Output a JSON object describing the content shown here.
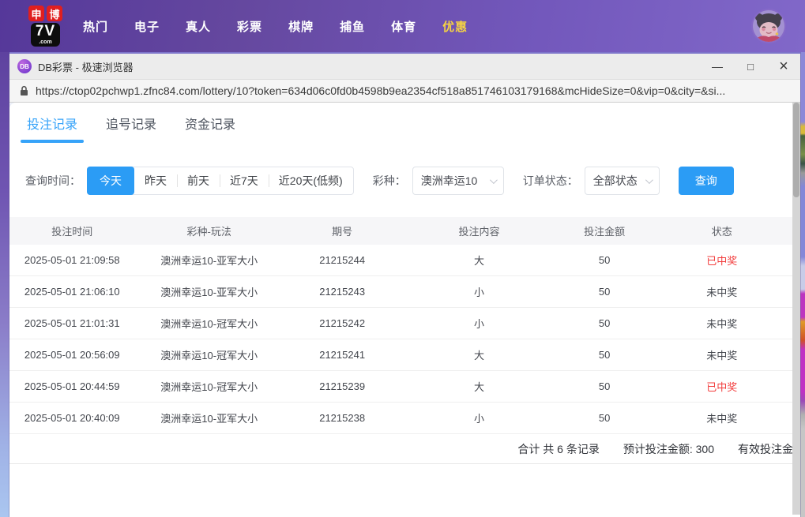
{
  "top_nav": {
    "logo": {
      "badge_left": "申",
      "badge_right": "博",
      "main": "7V",
      "sub": ".com"
    },
    "items": [
      {
        "label": "热门"
      },
      {
        "label": "电子"
      },
      {
        "label": "真人"
      },
      {
        "label": "彩票"
      },
      {
        "label": "棋牌"
      },
      {
        "label": "捕鱼"
      },
      {
        "label": "体育"
      },
      {
        "label": "优惠",
        "highlighted": true
      }
    ]
  },
  "browser": {
    "title": "DB彩票 - 极速浏览器",
    "favicon_text": "DB",
    "url": "https://ctop02pchwp1.zfnc84.com/lottery/10?token=634d06c0fd0b4598b9ea2354cf518a851746103179168&mcHideSize=0&vip=0&city=&si...",
    "controls": {
      "minimize": "—",
      "maximize": "□",
      "close": "×"
    }
  },
  "tabs": [
    {
      "label": "投注记录",
      "active": true
    },
    {
      "label": "追号记录",
      "active": false
    },
    {
      "label": "资金记录",
      "active": false
    }
  ],
  "filters": {
    "time_label": "查询时间：",
    "time_options": [
      {
        "label": "今天",
        "active": true
      },
      {
        "label": "昨天",
        "active": false
      },
      {
        "label": "前天",
        "active": false
      },
      {
        "label": "近7天",
        "active": false
      },
      {
        "label": "近20天(低频)",
        "active": false
      }
    ],
    "lottery_label": "彩种：",
    "lottery_value": "澳洲幸运10",
    "status_label": "订单状态：",
    "status_value": "全部状态",
    "search_label": "查询"
  },
  "table": {
    "columns": [
      "投注时间",
      "彩种-玩法",
      "期号",
      "投注内容",
      "投注金额",
      "状态"
    ],
    "rows": [
      {
        "time": "2025-05-01 21:09:58",
        "game": "澳洲幸运10-亚军大小",
        "issue": "21215244",
        "content": "大",
        "amount": "50",
        "status": "已中奖",
        "won": true
      },
      {
        "time": "2025-05-01 21:06:10",
        "game": "澳洲幸运10-亚军大小",
        "issue": "21215243",
        "content": "小",
        "amount": "50",
        "status": "未中奖",
        "won": false
      },
      {
        "time": "2025-05-01 21:01:31",
        "game": "澳洲幸运10-冠军大小",
        "issue": "21215242",
        "content": "小",
        "amount": "50",
        "status": "未中奖",
        "won": false
      },
      {
        "time": "2025-05-01 20:56:09",
        "game": "澳洲幸运10-冠军大小",
        "issue": "21215241",
        "content": "大",
        "amount": "50",
        "status": "未中奖",
        "won": false
      },
      {
        "time": "2025-05-01 20:44:59",
        "game": "澳洲幸运10-冠军大小",
        "issue": "21215239",
        "content": "大",
        "amount": "50",
        "status": "已中奖",
        "won": true
      },
      {
        "time": "2025-05-01 20:40:09",
        "game": "澳洲幸运10-亚军大小",
        "issue": "21215238",
        "content": "小",
        "amount": "50",
        "status": "未中奖",
        "won": false
      }
    ],
    "summary": {
      "count": "合计 共 6 条记录",
      "expected": "预计投注金额: 300",
      "valid_truncated": "有效投注金"
    }
  },
  "colors": {
    "accent_blue": "#2b9cf5",
    "win_red": "#f23c3c",
    "nav_highlight": "#f5d243"
  }
}
